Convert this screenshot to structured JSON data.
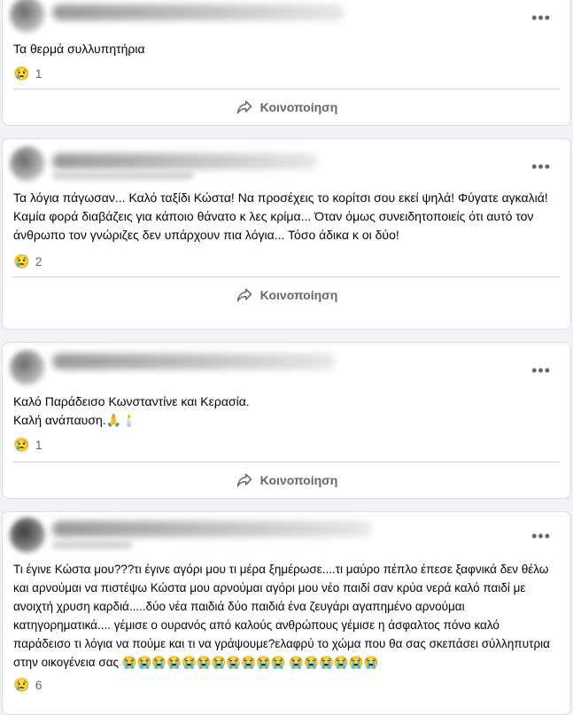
{
  "icons": {
    "more": "more-dots-icon",
    "share": "share-arrow-icon",
    "reaction": "crying-face-icon"
  },
  "posts": [
    {
      "text": "Τα θερμά συλλυπητήρια",
      "reaction_emoji": "😢",
      "reaction_count": "1",
      "share_label": "Κοινοποίηση"
    },
    {
      "text": "Τα λόγια πάγωσαν... Καλό ταξίδι Κώστα! Να προσέχεις το κορίτσι σου εκεί ψηλά! Φύγατε αγκαλιά! Καμία φορά διαβάζεις για κάποιο θάνατο κ λες κρίμα... Όταν όμως συνειδητοποιείς ότι αυτό τον άνθρωπο τον γνώριζες δεν υπάρχουν πια λόγια... Τόσο άδικα κ οι δύο!",
      "reaction_emoji": "😢",
      "reaction_count": "2",
      "share_label": "Κοινοποίηση"
    },
    {
      "text": "Καλό Παράδεισο Κωνσταντίνε και Κερασία.\nΚαλή ανάπαυση.🙏🕯️",
      "reaction_emoji": "😢",
      "reaction_count": "1",
      "share_label": "Κοινοποίηση"
    },
    {
      "text": "Τι έγινε Κώστα μου???τι έγινε αγόρι μου τι μέρα ξημέρωσε....τι μαύρο πέπλο έπεσε ξαφνικά δεν θέλω και αρνούμαι να πιστέψω Κώστα μου αρνούμαι αγόρι μου νέο παιδί σαν κρύα νερά καλό παιδί με ανοιχτή χρυση καρδιά.....δύο νέα παιδιά δύο παιδιά ένα ζευγάρι αγαπημένο αρνούμαι κατηγορηματικά.... γέμισε ο ουρανός από καλούς ανθρώπους γέμισε η άσφαλτος πόνο καλό παράδεισο τι λόγια να πούμε και τι να γράψουμε?ελαφρύ το χώμα που θα σας σκεπάσει σύλληπυτρια στην οικογένεια σας 😭😭😭😭😭😭😭😭😭😭😭 😭😭😭😭😭😭",
      "reaction_emoji": "😢",
      "reaction_count": "6"
    }
  ]
}
